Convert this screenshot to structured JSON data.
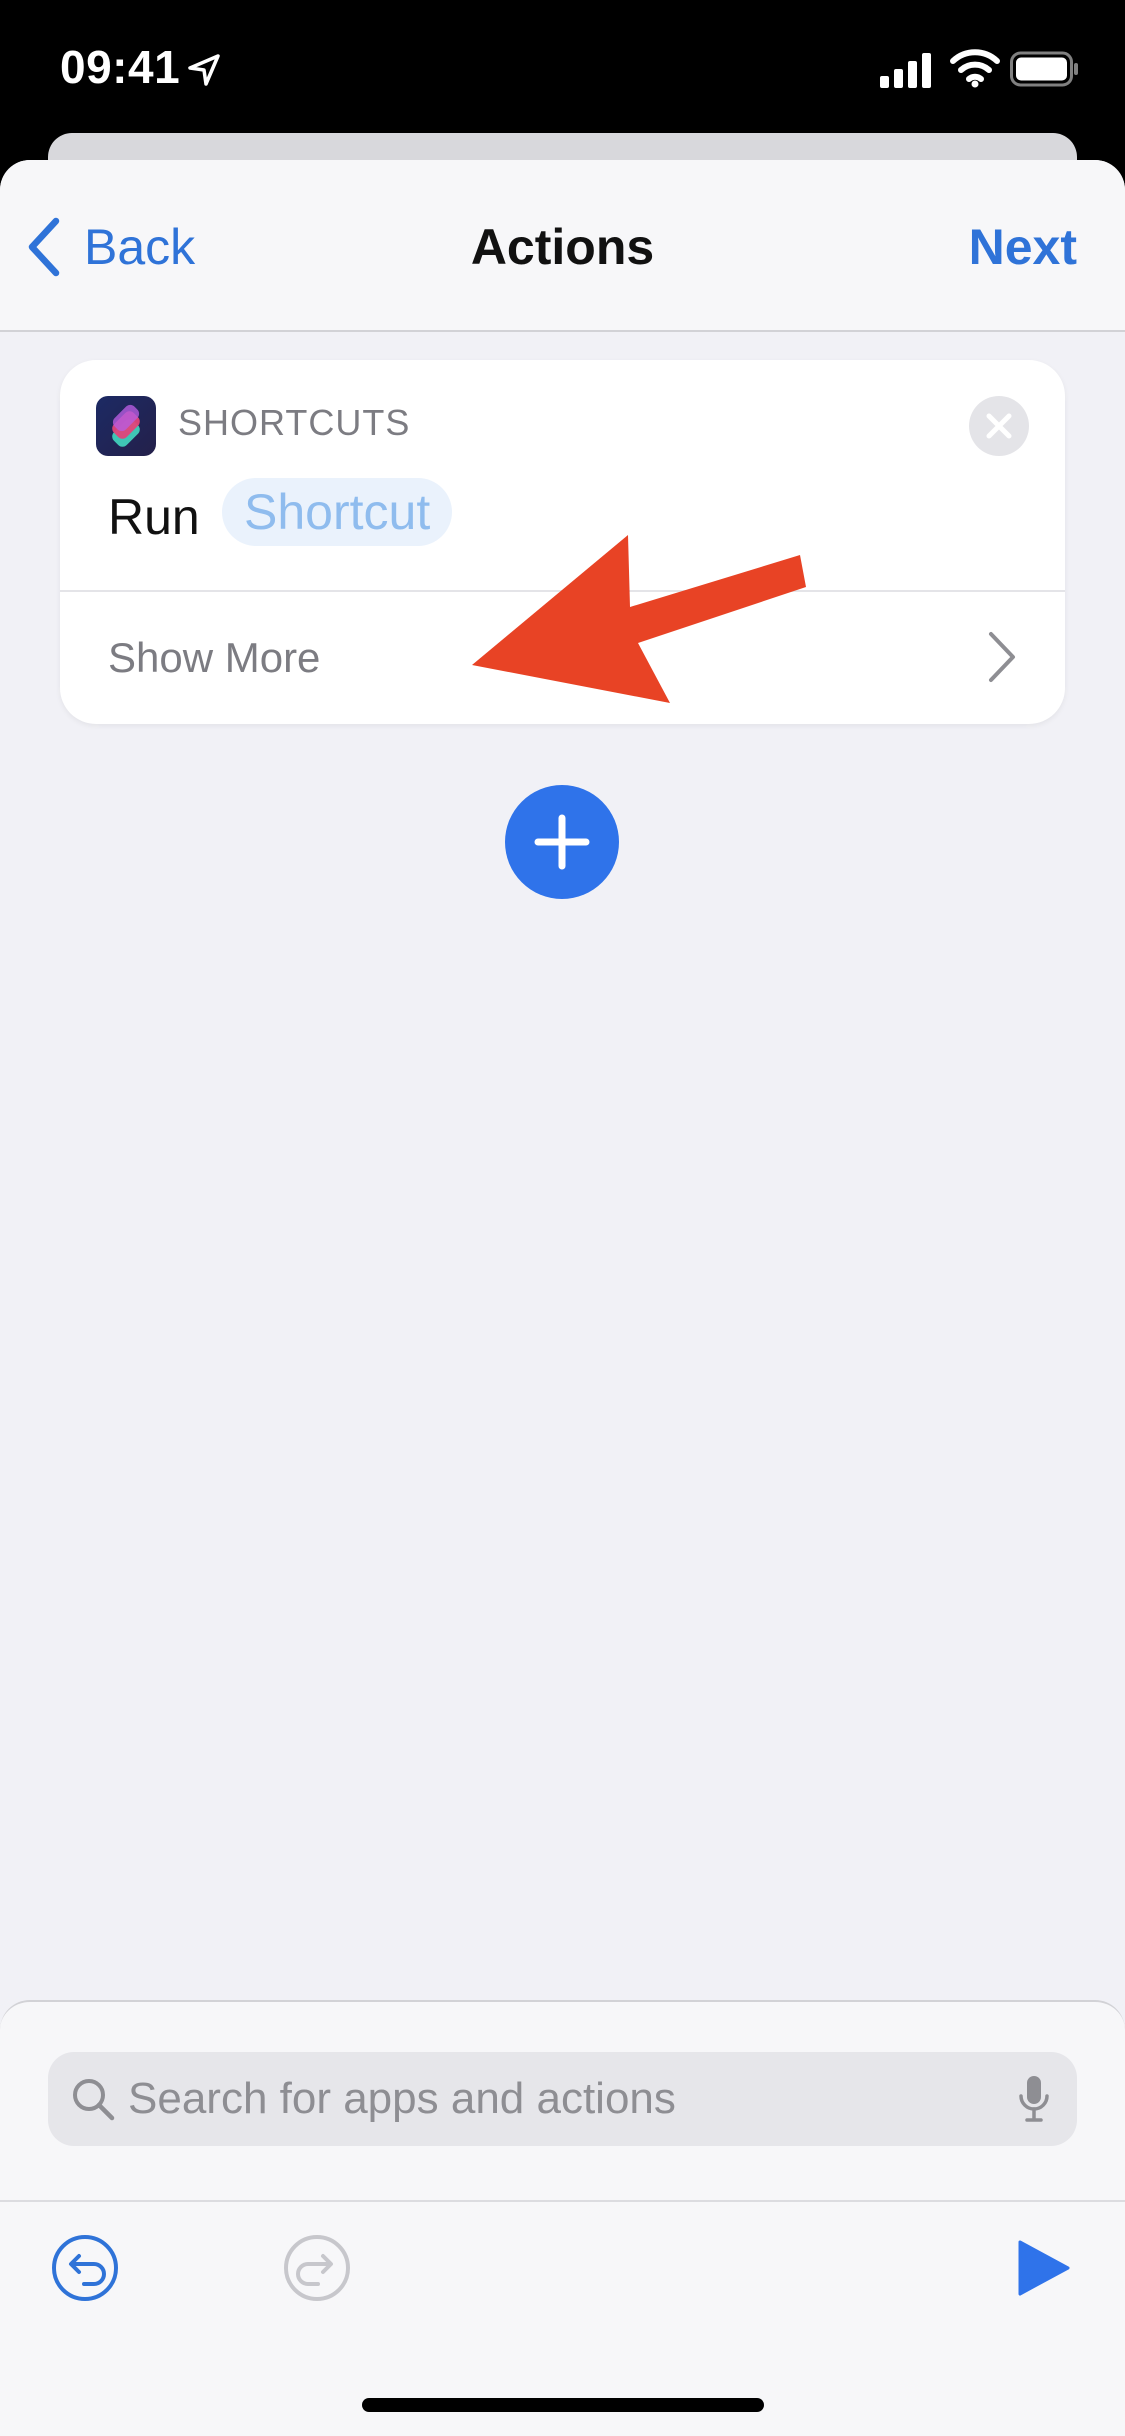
{
  "status_bar": {
    "time": "09:41"
  },
  "nav": {
    "back_label": "Back",
    "title": "Actions",
    "next_label": "Next"
  },
  "action_card": {
    "app_name": "SHORTCUTS",
    "action_verb": "Run",
    "parameter": "Shortcut",
    "show_more_label": "Show More"
  },
  "search": {
    "placeholder": "Search for apps and actions"
  },
  "icons": {
    "back": "chevron-left-icon",
    "close": "close-icon",
    "chevron_right": "chevron-right-icon",
    "add": "plus-icon",
    "search": "search-icon",
    "mic": "microphone-icon",
    "undo": "undo-icon",
    "redo": "redo-icon",
    "play": "play-icon"
  },
  "colors": {
    "accent": "#2f73d8",
    "annotation": "#e84325",
    "parameter_text": "#8fbcee",
    "parameter_bg": "#eaf2fc"
  }
}
